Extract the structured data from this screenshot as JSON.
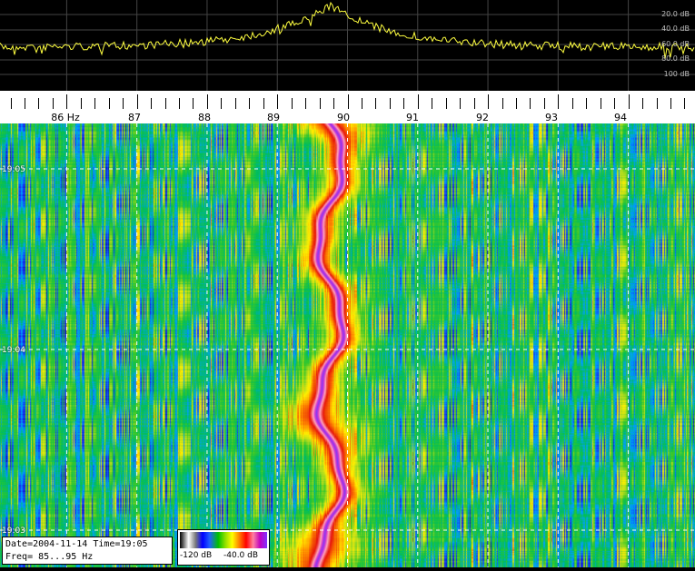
{
  "spectrum": {
    "db_labels": [
      "20.0 dB",
      "40.0 dB",
      "60.0 dB",
      "80.0 dB",
      "100 dB"
    ],
    "line_color": "#ffff40",
    "peak_frequency_hz": 89.75
  },
  "ruler": {
    "unit": "Hz",
    "freq_labels": [
      "86",
      "87",
      "88",
      "89",
      "90",
      "91",
      "92",
      "93",
      "94"
    ],
    "range_hz": [
      85.05,
      94.95
    ]
  },
  "waterfall": {
    "time_labels": [
      "19:05",
      "19:04",
      "19:03"
    ],
    "signal_center_hz": 89.75
  },
  "info": {
    "line1": "Date=2004-11-14 Time=19:05",
    "line2": "Freq= 85...95 Hz"
  },
  "colorbar": {
    "min_label": "-120 dB",
    "max_label": "-40.0 dB"
  }
}
